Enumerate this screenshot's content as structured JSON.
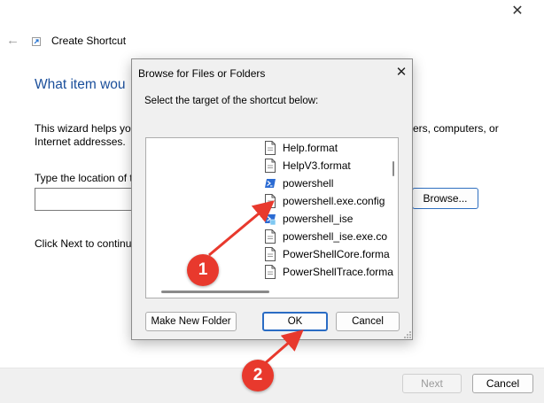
{
  "window": {
    "title": "Create Shortcut",
    "close_glyph": "✕",
    "back_glyph": "←",
    "heading": "What item wou",
    "description_left": "This wizard helps you",
    "description_left2": "Internet addresses.",
    "description_right": "ers, computers, or",
    "type_label": "Type the location of t",
    "browse_label": "Browse...",
    "click_next": "Click Next to continu",
    "next_label": "Next",
    "cancel_label": "Cancel"
  },
  "dialog": {
    "title": "Browse for Files or Folders",
    "close_glyph": "✕",
    "prompt": "Select the target of the shortcut below:",
    "files": [
      {
        "name": "Help.format",
        "icon": "document-icon"
      },
      {
        "name": "HelpV3.format",
        "icon": "document-icon"
      },
      {
        "name": "powershell",
        "icon": "powershell-icon"
      },
      {
        "name": "powershell.exe.config",
        "icon": "document-icon"
      },
      {
        "name": "powershell_ise",
        "icon": "powershell-ise-icon"
      },
      {
        "name": "powershell_ise.exe.co",
        "icon": "document-icon"
      },
      {
        "name": "PowerShellCore.forma",
        "icon": "document-icon"
      },
      {
        "name": "PowerShellTrace.forma",
        "icon": "document-icon"
      }
    ],
    "new_folder_label": "Make New Folder",
    "ok_label": "OK",
    "cancel_label": "Cancel"
  },
  "annotations": [
    {
      "number": "1"
    },
    {
      "number": "2"
    }
  ],
  "colors": {
    "annotation_red": "#e8392d",
    "accent_blue": "#2a6cc4",
    "heading_blue": "#1b4f9b"
  }
}
